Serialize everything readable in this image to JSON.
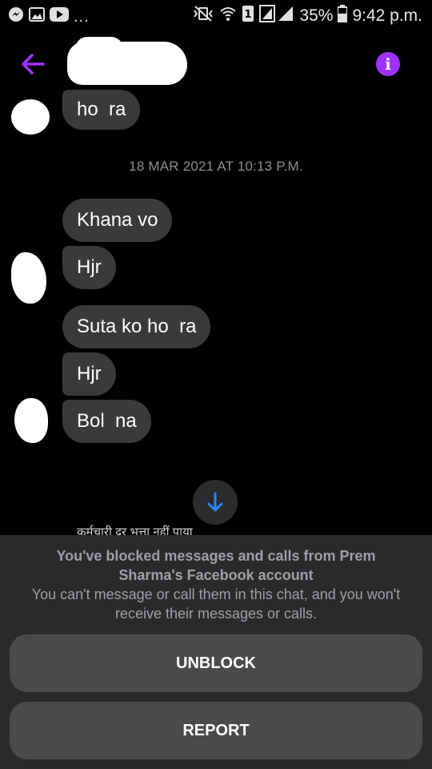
{
  "status_bar": {
    "left_icons": [
      "messenger-icon",
      "image-icon",
      "youtube-icon"
    ],
    "dots": "...",
    "right_icons": [
      "mute-vibrate-icon",
      "wifi-icon",
      "sim-icon",
      "signal-icon"
    ],
    "battery": "35%",
    "time": "9:42 p.m."
  },
  "header": {
    "back_icon": "arrow-left-icon",
    "info_icon": "info-icon",
    "info_symbol": "i",
    "accent": "#a033ff"
  },
  "messages": {
    "top_partial": "ho  ra",
    "timestamp": "18 MAR 2021 AT 10:13 P.M.",
    "group": [
      "Khana vo",
      "Hjr",
      "Suta ko ho  ra",
      "Hjr",
      "Bol  na"
    ],
    "bubble_color": "#3a3a3c",
    "partial_bottom_text": "कर्मचारी दर भत्ता नहीं पाया"
  },
  "scroll_button": {
    "icon": "arrow-down-icon",
    "color": "#1e8cff"
  },
  "blocked": {
    "title": "You've blocked messages and calls from Prem Sharma's Facebook account",
    "description": "You can't message or call them in this chat, and you won't receive their messages or calls.",
    "unblock_label": "UNBLOCK",
    "report_label": "REPORT"
  }
}
